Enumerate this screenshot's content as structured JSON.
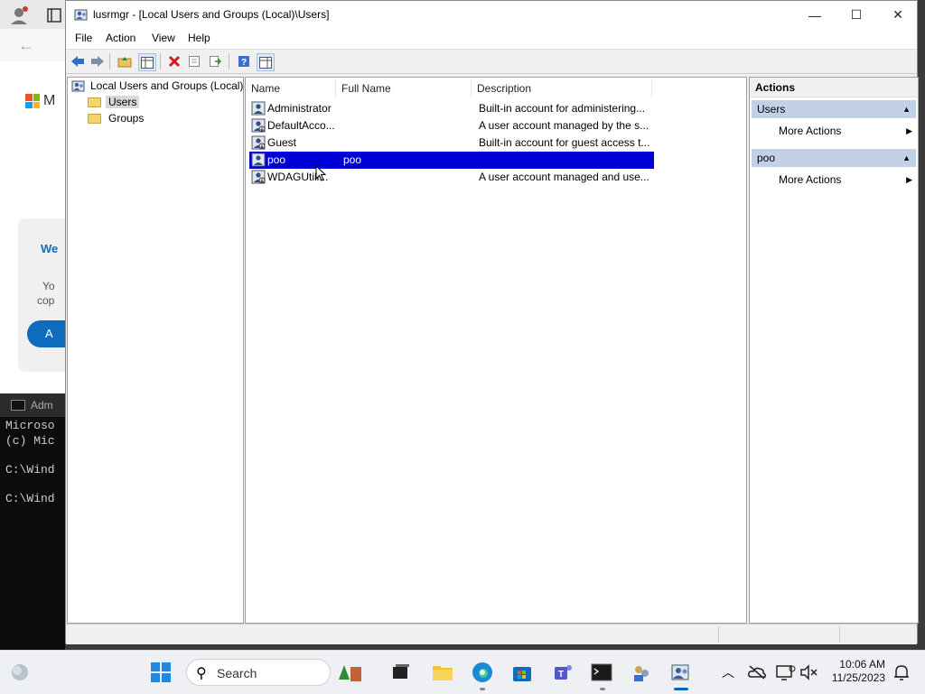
{
  "window": {
    "title": "lusrmgr - [Local Users and Groups (Local)\\Users]",
    "minimize_label": "—",
    "maximize_label": "☐",
    "close_label": "✕"
  },
  "menu": [
    "File",
    "Action",
    "View",
    "Help"
  ],
  "tree": {
    "root": "Local Users and Groups (Local)",
    "items": [
      "Users",
      "Groups"
    ]
  },
  "list": {
    "columns": [
      "Name",
      "Full Name",
      "Description"
    ],
    "rows": [
      {
        "name": "Administrator",
        "full_name": "",
        "description": "Built-in account for administering..."
      },
      {
        "name": "DefaultAcco...",
        "full_name": "",
        "description": "A user account managed by the s..."
      },
      {
        "name": "Guest",
        "full_name": "",
        "description": "Built-in account for guest access t..."
      },
      {
        "name": "poo",
        "full_name": "poo",
        "description": ""
      },
      {
        "name": "WDAGUtili...",
        "full_name": "",
        "description": "A user account managed and use..."
      }
    ],
    "selected_row": "poo"
  },
  "actions": {
    "title": "Actions",
    "sections": [
      {
        "label": "Users",
        "items": [
          "More Actions"
        ]
      },
      {
        "label": "poo",
        "items": [
          "More Actions"
        ]
      }
    ]
  },
  "background": {
    "terminal_tab": "Adm",
    "terminal_lines": [
      "Microso",
      "(c) Mic",
      "C:\\Wind",
      "C:\\Wind"
    ],
    "browser_text": [
      "M",
      "We",
      "Yo",
      "cop",
      "A"
    ]
  },
  "taskbar": {
    "search_label": "Search",
    "time": "10:06 AM",
    "date": "11/25/2023"
  },
  "colors": {
    "selection": "#0000d6",
    "actions_section": "#c3d1e6",
    "accent": "#0067c0"
  }
}
